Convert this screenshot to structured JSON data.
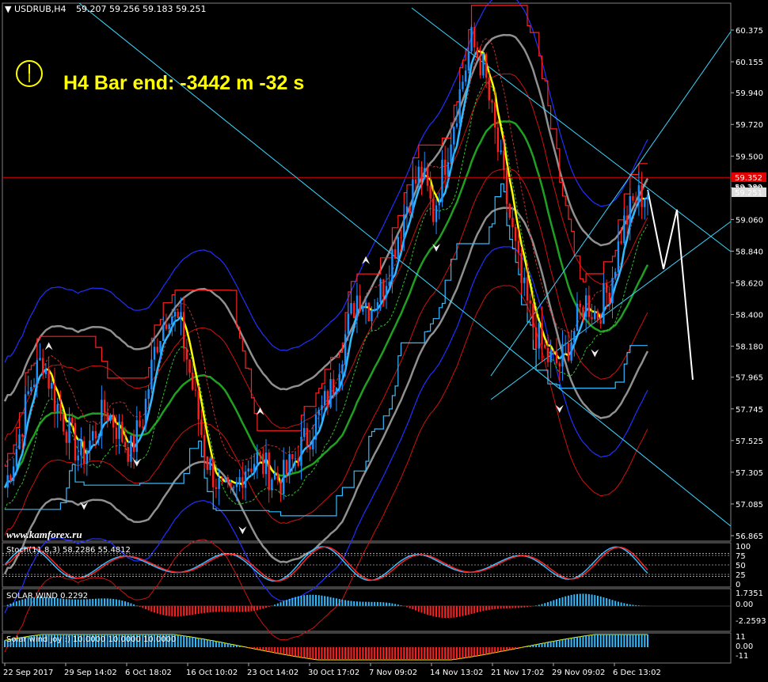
{
  "header": {
    "symbol": "USDRUB,H4",
    "ohlc": "59.207 59.256 59.183 59.251"
  },
  "timer_text": "H4 Bar end: -3442 m -32 s",
  "watermark": "www.kamforex.ru",
  "colors": {
    "bg": "#000000",
    "bull": "#1e90ff",
    "bear": "#ff2020",
    "yellow_line": "#ffff00",
    "cyan_line": "#33bbff",
    "green_ma": "#20a020",
    "gray_band": "#909090",
    "blue_band": "#2030ff",
    "red_band": "#d01010",
    "channel": "#3ad6ff",
    "timer": "#ffff00"
  },
  "chart_data": {
    "type": "candlestick",
    "price_axis": {
      "ticks": [
        "60.375",
        "60.155",
        "59.940",
        "59.720",
        "59.500",
        "59.280",
        "59.060",
        "58.840",
        "58.620",
        "58.400",
        "58.180",
        "57.965",
        "57.745",
        "57.525",
        "57.305",
        "57.085",
        "56.865"
      ],
      "range": [
        56.865,
        60.375
      ],
      "current_price": "59.251",
      "red_level_label": "59.352",
      "extra_label": "59.280"
    },
    "time_axis": {
      "labels": [
        "22 Sep 2017",
        "29 Sep 14:02",
        "6 Oct 18:02",
        "16 Oct 10:02",
        "23 Oct 14:02",
        "30 Oct 17:02",
        "7 Nov 09:02",
        "14 Nov 13:02",
        "21 Nov 17:02",
        "29 Nov 09:02",
        "6 Dec 13:02"
      ]
    },
    "series": {
      "closes": [
        57.2,
        57.5,
        57.9,
        58.1,
        57.8,
        57.6,
        57.4,
        57.55,
        57.75,
        57.6,
        57.45,
        57.7,
        58.2,
        58.45,
        58.3,
        57.85,
        57.4,
        57.2,
        57.1,
        57.35,
        57.4,
        57.3,
        57.25,
        57.4,
        57.55,
        57.7,
        57.9,
        58.25,
        58.55,
        58.45,
        58.6,
        58.9,
        59.2,
        59.4,
        59.1,
        59.5,
        59.9,
        60.3,
        60.1,
        59.6,
        59.1,
        58.6,
        58.3,
        58.1,
        58.05,
        58.25,
        58.5,
        58.4,
        58.6,
        59.0,
        59.2,
        59.25
      ]
    },
    "stoch": {
      "label": "Stoch(11,8,3)  58.2286  55.4812",
      "axis": [
        "100",
        "75",
        "50",
        "25",
        "0"
      ]
    },
    "solar_wind": {
      "label": "SOLAR WIND 0.2292",
      "axis": [
        "1.7351",
        "0.00",
        "-2.2593"
      ]
    },
    "solar_joy": {
      "label": "Solar wind joy :)  10.0000  10.0000  10.0000",
      "axis": [
        "11",
        "0.00",
        "-11"
      ]
    }
  }
}
